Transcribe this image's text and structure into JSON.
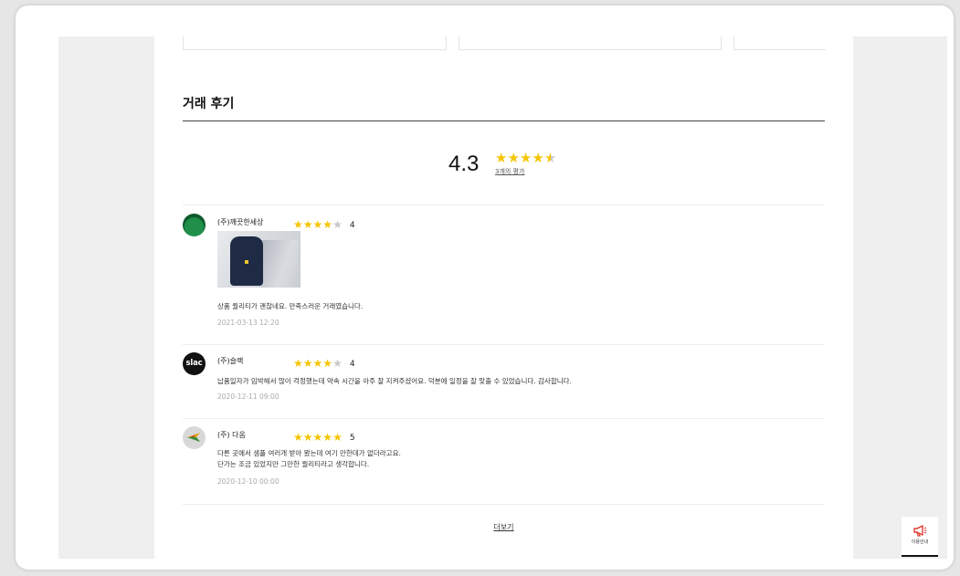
{
  "section": {
    "title": "거래 후기"
  },
  "summary": {
    "average": "4.3",
    "stars": [
      "full",
      "full",
      "full",
      "full",
      "half"
    ],
    "count_label": "3개의 평가"
  },
  "reviews": [
    {
      "author": "(주)깨끗한세상",
      "rating": "4",
      "stars": [
        "full",
        "full",
        "full",
        "full",
        "empty"
      ],
      "has_photo": true,
      "text": [
        "상품 퀄리티가 괜찮네요. 만족스러운 거래였습니다."
      ],
      "date": "2021-03-13 12:20"
    },
    {
      "author": "(주)슬랙",
      "avatar_text": "slac",
      "rating": "4",
      "stars": [
        "full",
        "full",
        "full",
        "full",
        "empty"
      ],
      "has_photo": false,
      "text": [
        "납품일자가 임박해서 많이 걱정했는데 약속 시간을 아주 잘 지켜주셨어요. 덕분에 일정을 잘 맞출 수 있었습니다. 감사합니다."
      ],
      "date": "2020-12-11 09:00"
    },
    {
      "author": "(주) 다옴",
      "rating": "5",
      "stars": [
        "full",
        "full",
        "full",
        "full",
        "full"
      ],
      "has_photo": false,
      "text": [
        "다른 곳에서 샘플 여러개 받아 봤는데 여기 만한데가 없더라고요.",
        "단가는 조금 있었지만 그만한 퀄리티라고 생각합니다."
      ],
      "date": "2020-12-10 00:00"
    }
  ],
  "more_label": "더보기",
  "side_button": {
    "label": "이용안내",
    "icon": "megaphone-icon"
  },
  "colors": {
    "star": "#f5c400",
    "star_empty": "#c9c9c9",
    "side_icon": "#e03a2f"
  }
}
